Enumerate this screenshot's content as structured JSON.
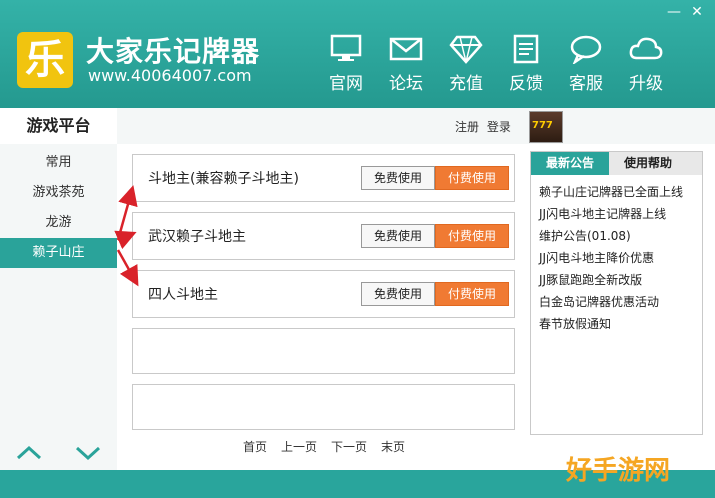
{
  "app": {
    "logo_char": "乐",
    "title": "大家乐记牌器",
    "url": "www.40064007.com"
  },
  "window_controls": {
    "minimize": "—",
    "close": "✕"
  },
  "nav": [
    {
      "label": "官网",
      "icon": "monitor-icon"
    },
    {
      "label": "论坛",
      "icon": "envelope-icon"
    },
    {
      "label": "充值",
      "icon": "diamond-icon"
    },
    {
      "label": "反馈",
      "icon": "document-icon"
    },
    {
      "label": "客服",
      "icon": "chat-bubble-icon"
    },
    {
      "label": "升级",
      "icon": "cloud-icon"
    }
  ],
  "sidebar": {
    "title": "游戏平台",
    "items": [
      {
        "label": "常用"
      },
      {
        "label": "游戏茶苑"
      },
      {
        "label": "龙游"
      },
      {
        "label": "赖子山庄",
        "active": true
      }
    ]
  },
  "auth": {
    "register": "注册",
    "login": "登录"
  },
  "games": [
    {
      "name": "斗地主(兼容赖子斗地主)",
      "free": "免费使用",
      "paid": "付费使用"
    },
    {
      "name": "武汉赖子斗地主",
      "free": "免费使用",
      "paid": "付费使用"
    },
    {
      "name": "四人斗地主",
      "free": "免费使用",
      "paid": "付费使用"
    }
  ],
  "pager": {
    "first": "首页",
    "prev": "上一页",
    "next": "下一页",
    "last": "末页"
  },
  "right_tabs": {
    "news": "最新公告",
    "help": "使用帮助"
  },
  "news": [
    "赖子山庄记牌器已全面上线",
    "JJ闪电斗地主记牌器上线",
    "维护公告(01.08)",
    "JJ闪电斗地主降价优惠",
    "JJ豚鼠跑跑全新改版",
    "白金岛记牌器优惠活动",
    "春节放假通知"
  ],
  "watermark": "好手游网",
  "colors": {
    "teal": "#2aa39a",
    "orange": "#f07a33",
    "arrow_red": "#d9222a",
    "logo_yellow": "#f1c40f"
  }
}
